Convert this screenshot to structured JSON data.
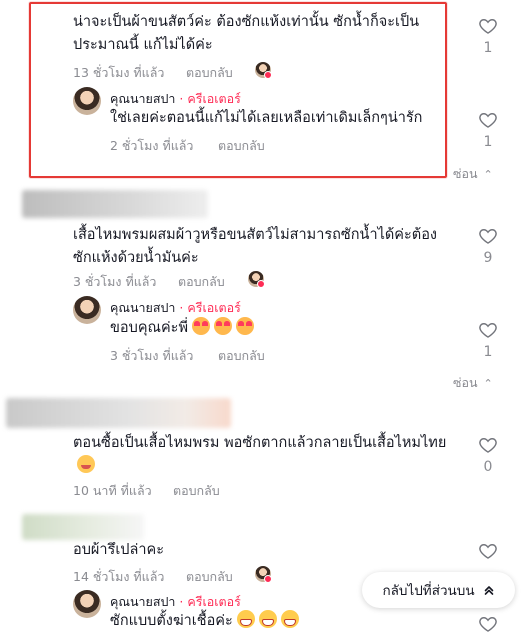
{
  "reply_label": "ตอบกลับ",
  "hide_label": "ซ่อน",
  "creator_suffix": "· ครีเอเตอร์",
  "back_to_top_label": "กลับไปที่ส่วนบน",
  "comments": [
    {
      "text": "น่าจะเป็นผ้าขนสัตว์ค่ะ ต้องซักแห้งเท่านั้น ซักน้ำก็จะเป็นประมาณนี้ แก้ไม่ได้ค่ะ",
      "time": "13 ชั่วโมง ที่แล้ว",
      "likes": "1",
      "reply": {
        "author": "คุณนายสปา",
        "text": "ใช่เลยค่ะตอนนี้แก้ไม่ได้เลยเหลือเท่าเดิมเล็กๆน่ารัก",
        "time": "2 ชั่วโมง ที่แล้ว",
        "likes": "1"
      }
    },
    {
      "text": "เสื้อไหมพรมผสมผ้าวูหรือขนสัตว์ไม่สามารถซักน้ำได้ค่ะต้องซักแห้งด้วยน้ำมันค่ะ",
      "time": "3 ชั่วโมง ที่แล้ว",
      "likes": "9",
      "reply": {
        "author": "คุณนายสปา",
        "text": "ขอบคุณค่ะพี่",
        "time": "3 ชั่วโมง ที่แล้ว",
        "likes": "1"
      }
    },
    {
      "text": "ตอนซื้อเป็นเสื้อไหมพรม พอซักตากแล้วกลายเป็นเสื้อไหมไทย",
      "time": "10 นาที ที่แล้ว",
      "likes": "0"
    },
    {
      "text": "อบผ้ารึเปล่าคะ",
      "time": "14 ชั่วโมง ที่แล้ว",
      "likes": "",
      "reply": {
        "author": "คุณนายสปา",
        "text": "ซักแบบตั้งฆ่าเชื้อค่ะ"
      }
    }
  ],
  "colors": {
    "highlight": "#e53935",
    "creator": "#fe2c55",
    "meta": "#8a8b91"
  },
  "icons": {
    "like": "heart-outline-icon",
    "hide": "chevron-up-icon",
    "back_to_top": "double-chevron-up-icon"
  }
}
